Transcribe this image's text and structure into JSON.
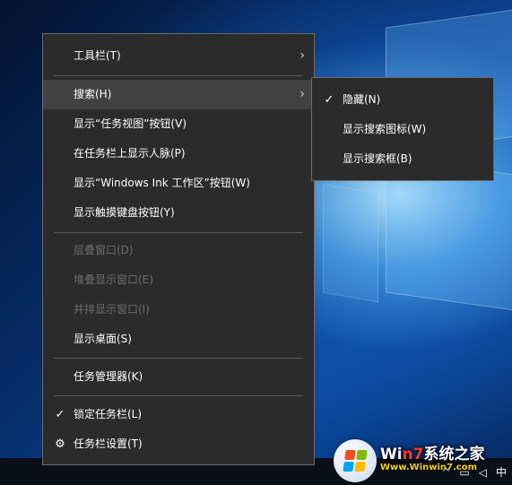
{
  "context_menu": {
    "items": [
      {
        "label": "工具栏(T)",
        "has_submenu": true
      },
      {
        "label": "搜索(H)",
        "has_submenu": true,
        "highlighted": true
      },
      {
        "label": "显示“任务视图”按钮(V)"
      },
      {
        "label": "在任务栏上显示人脉(P)"
      },
      {
        "label": "显示“Windows Ink 工作区”按钮(W)"
      },
      {
        "label": "显示触摸键盘按钮(Y)"
      },
      {
        "label": "层叠窗口(D)",
        "disabled": true
      },
      {
        "label": "堆叠显示窗口(E)",
        "disabled": true
      },
      {
        "label": "并排显示窗口(I)",
        "disabled": true
      },
      {
        "label": "显示桌面(S)"
      },
      {
        "label": "任务管理器(K)"
      },
      {
        "label": "锁定任务栏(L)",
        "checked": true,
        "lead_glyph": "✓"
      },
      {
        "label": "任务栏设置(T)",
        "icon": "gear-icon",
        "lead_glyph": "⚙"
      }
    ],
    "submenu_glyph": "›"
  },
  "search_submenu": {
    "items": [
      {
        "label": "隐藏(N)",
        "checked": true,
        "lead_glyph": "✓"
      },
      {
        "label": "显示搜索图标(W)"
      },
      {
        "label": "显示搜索框(B)"
      }
    ]
  },
  "watermark": {
    "brand_prefix": "Wi",
    "brand_seven": "n7",
    "brand_suffix": "系统之家",
    "subtitle": "Www.Winwin7.com"
  },
  "tray": {
    "chevron_glyph": "^",
    "network_glyph": "▭",
    "volume_glyph": "◁",
    "ime_glyph": "中"
  },
  "colors": {
    "menu_bg": "#2b2b2b",
    "menu_hover": "#414141",
    "menu_border": "#6b6b6b",
    "disabled_text": "#6d6d6d"
  }
}
